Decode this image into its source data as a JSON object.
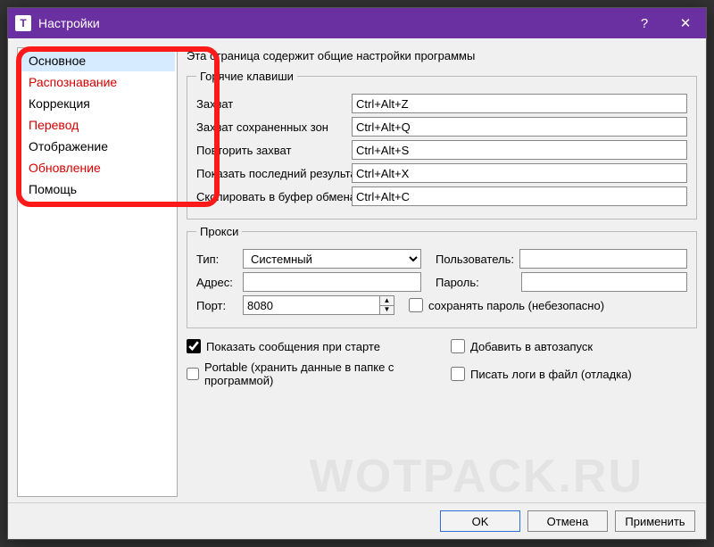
{
  "window": {
    "title": "Настройки"
  },
  "sidebar": {
    "items": [
      {
        "label": "Основное",
        "selected": true,
        "warn": false
      },
      {
        "label": "Распознавание",
        "selected": false,
        "warn": true
      },
      {
        "label": "Коррекция",
        "selected": false,
        "warn": false
      },
      {
        "label": "Перевод",
        "selected": false,
        "warn": true
      },
      {
        "label": "Отображение",
        "selected": false,
        "warn": false
      },
      {
        "label": "Обновление",
        "selected": false,
        "warn": true
      },
      {
        "label": "Помощь",
        "selected": false,
        "warn": false
      }
    ]
  },
  "page": {
    "description": "Эта страница содержит общие настройки программы"
  },
  "hotkeys": {
    "legend": "Горячие клавиши",
    "rows": [
      {
        "label": "Захват",
        "value": "Ctrl+Alt+Z"
      },
      {
        "label": "Захват сохраненных зон",
        "value": "Ctrl+Alt+Q"
      },
      {
        "label": "Повторить захват",
        "value": "Ctrl+Alt+S"
      },
      {
        "label": "Показать последний результат",
        "value": "Ctrl+Alt+X"
      },
      {
        "label": "Скопировать в буфер обмена",
        "value": "Ctrl+Alt+C"
      }
    ]
  },
  "proxy": {
    "legend": "Прокси",
    "type_label": "Тип:",
    "type_value": "Системный",
    "addr_label": "Адрес:",
    "addr_value": "",
    "port_label": "Порт:",
    "port_value": "8080",
    "user_label": "Пользователь:",
    "user_value": "",
    "pass_label": "Пароль:",
    "pass_value": "",
    "save_pwd_label": "сохранять пароль (небезопасно)",
    "save_pwd_checked": false
  },
  "options": {
    "show_messages": {
      "label": "Показать сообщения при старте",
      "checked": true
    },
    "autostart": {
      "label": "Добавить в автозапуск",
      "checked": false
    },
    "portable": {
      "label": "Portable (хранить данные в папке с программой)",
      "checked": false
    },
    "write_logs": {
      "label": "Писать логи в файл (отладка)",
      "checked": false
    }
  },
  "buttons": {
    "ok": "OK",
    "cancel": "Отмена",
    "apply": "Применить"
  },
  "watermark": "WOTPACK.RU"
}
